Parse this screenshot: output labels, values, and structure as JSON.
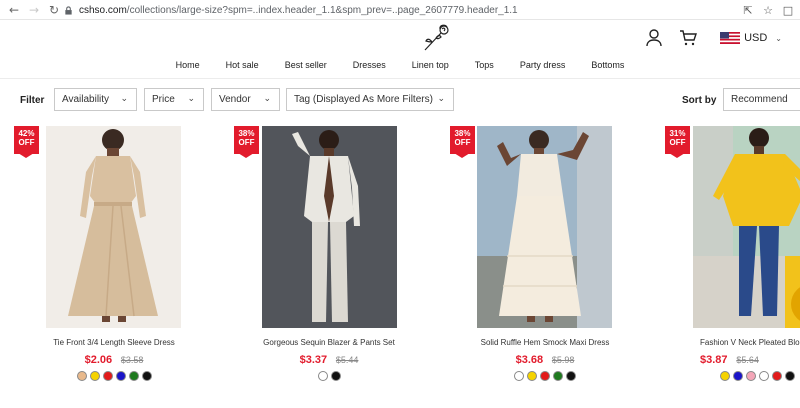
{
  "browser": {
    "url_host": "cshso.com",
    "url_path": "/collections/large-size?spm=..index.header_1.1&spm_prev=..page_2607779.header_1.1"
  },
  "header": {
    "currency": "USD",
    "nav": [
      "Home",
      "Hot sale",
      "Best seller",
      "Dresses",
      "Linen top",
      "Tops",
      "Party dress",
      "Bottoms"
    ]
  },
  "filters": {
    "label": "Filter",
    "availability": "Availability",
    "price": "Price",
    "vendor": "Vendor",
    "tag": "Tag (Displayed As More Filters)",
    "sort_label": "Sort by",
    "sort_value": "Recommend"
  },
  "products": [
    {
      "badge_pct": "42%",
      "badge_off": "OFF",
      "name": "Tie Front 3/4 Length Sleeve Dress",
      "price": "$2.06",
      "old_price": "$3.58",
      "swatches": [
        "#e8b98c",
        "#f5d300",
        "#e21b1b",
        "#1a14c8",
        "#1f7a1f",
        "#111111"
      ]
    },
    {
      "badge_pct": "38%",
      "badge_off": "OFF",
      "name": "Gorgeous Sequin Blazer & Pants Set",
      "price": "$3.37",
      "old_price": "$5.44",
      "swatches": [
        "#ffffff",
        "#111111"
      ]
    },
    {
      "badge_pct": "38%",
      "badge_off": "OFF",
      "name": "Solid Ruffle Hem Smock Maxi Dress",
      "price": "$3.68",
      "old_price": "$5.98",
      "swatches": [
        "#ffffff",
        "#f5d300",
        "#e21b1b",
        "#1f7a1f",
        "#111111"
      ]
    },
    {
      "badge_pct": "31%",
      "badge_off": "OFF",
      "name": "Fashion V Neck Pleated Blouse",
      "price": "$3.87",
      "old_price": "$5.64",
      "swatches": [
        "#f5d300",
        "#1a14c8",
        "#f4a6b8",
        "#ffffff",
        "#e21b1b",
        "#111111"
      ]
    }
  ]
}
